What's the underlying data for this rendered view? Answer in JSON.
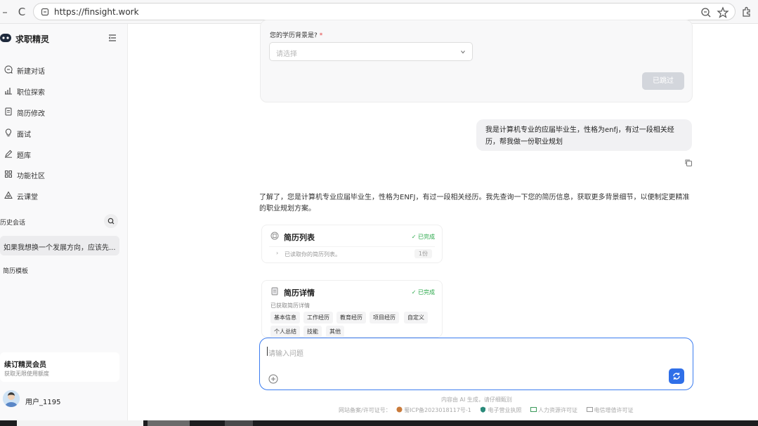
{
  "browser": {
    "url": "https://finsight.work",
    "back_icon": "back-arrow-icon",
    "reload_icon": "reload-icon"
  },
  "sidebar": {
    "brand": "求职精灵",
    "items": [
      {
        "label": "新建对话",
        "icon": "chat-plus-icon"
      },
      {
        "label": "职位探索",
        "icon": "bar-chart-icon"
      },
      {
        "label": "简历修改",
        "icon": "document-icon"
      },
      {
        "label": "面试",
        "icon": "lightbulb-icon"
      },
      {
        "label": "题库",
        "icon": "pencil-icon"
      },
      {
        "label": "功能社区",
        "icon": "grid-icon"
      },
      {
        "label": "云课堂",
        "icon": "cloud-class-icon"
      }
    ],
    "history_title": "历史会话",
    "history_items": [
      "如果我想换一个发展方向，应该先..."
    ],
    "resume_template": "简历模板",
    "member": {
      "title": "续订精灵会员",
      "subtitle": "获取无限使用额度"
    },
    "username": "用户_1195"
  },
  "form": {
    "label": "您的学历背景是?",
    "required_mark": "*",
    "select_placeholder": "请选择",
    "skip_button": "已跳过"
  },
  "user_message": "我是计算机专业的应届毕业生，性格为enfj，有过一段相关经历，帮我做一份职业规划",
  "ai_message": "了解了，您是计算机专业应届毕业生，性格为ENFJ，有过一段相关经历。我先查询一下您的简历信息，获取更多背景细节，以便制定更精准的职业规划方案。",
  "tool_cards": [
    {
      "title": "简历列表",
      "status": "✓ 已完成",
      "row_text": "已读取你的简历列表。",
      "row_count": "1份"
    },
    {
      "title": "简历详情",
      "status": "✓ 已完成",
      "subtitle": "已获取简历详情",
      "tags": [
        "基本信息",
        "工作经历",
        "教育经历",
        "项目经历",
        "自定义",
        "个人总结",
        "技能",
        "其他"
      ]
    }
  ],
  "input": {
    "placeholder": "请输入问题"
  },
  "disclaimer": "内容由 AI 生成，请仔细甄别",
  "footer": {
    "license_label": "网站备案/许可证号：",
    "icp": "蜀ICP备2023018117号-1",
    "business_license": "电子营业执照",
    "hr_license": "人力资源许可证",
    "telecom_license": "电信增值许可证"
  },
  "colors": {
    "accent": "#2f6fe8",
    "success": "#2aa84a",
    "required": "#e23b3b"
  }
}
